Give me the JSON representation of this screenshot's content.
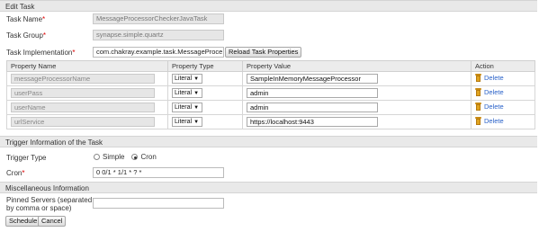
{
  "edit_task": {
    "header": "Edit Task",
    "task_name_label": "Task Name",
    "task_name_value": "MessageProcessorCheckerJavaTask",
    "task_group_label": "Task Group",
    "task_group_value": "synapse.simple.quartz",
    "task_impl_label": "Task Implementation",
    "task_impl_value": "com.chakray.example.task.MessageProce",
    "reload_button": "Reload Task Properties",
    "required_mark": "*"
  },
  "properties_table": {
    "columns": [
      "Property Name",
      "Property Type",
      "Property Value",
      "Action"
    ],
    "rows": [
      {
        "name": "messageProcessorName",
        "type": "Literal",
        "value": "SampleInMemoryMessageProcessor",
        "action": "Delete"
      },
      {
        "name": "userPass",
        "type": "Literal",
        "value": "admin",
        "action": "Delete"
      },
      {
        "name": "userName",
        "type": "Literal",
        "value": "admin",
        "action": "Delete"
      },
      {
        "name": "urlService",
        "type": "Literal",
        "value": "https://localhost:9443",
        "action": "Delete"
      }
    ]
  },
  "trigger": {
    "header": "Trigger Information of the Task",
    "type_label": "Trigger Type",
    "option_simple": "Simple",
    "option_cron": "Cron",
    "selected": "Cron",
    "cron_label": "Cron",
    "cron_value": "0 0/1 * 1/1 * ? *"
  },
  "misc": {
    "header": "Miscellaneous Information",
    "pinned_label_line1": "Pinned Servers (separated",
    "pinned_label_line2": "by comma or space)",
    "pinned_value": ""
  },
  "actions": {
    "schedule": "Schedule",
    "cancel": "Cancel"
  },
  "icons": {
    "delete_icon": "trash-icon",
    "dropdown_icon": "caret-down-icon"
  },
  "colors": {
    "link": "#2a62c9",
    "required": "#dd0000",
    "header_bg": "#e9e9e9",
    "readonly_bg": "#e6e6e6"
  }
}
